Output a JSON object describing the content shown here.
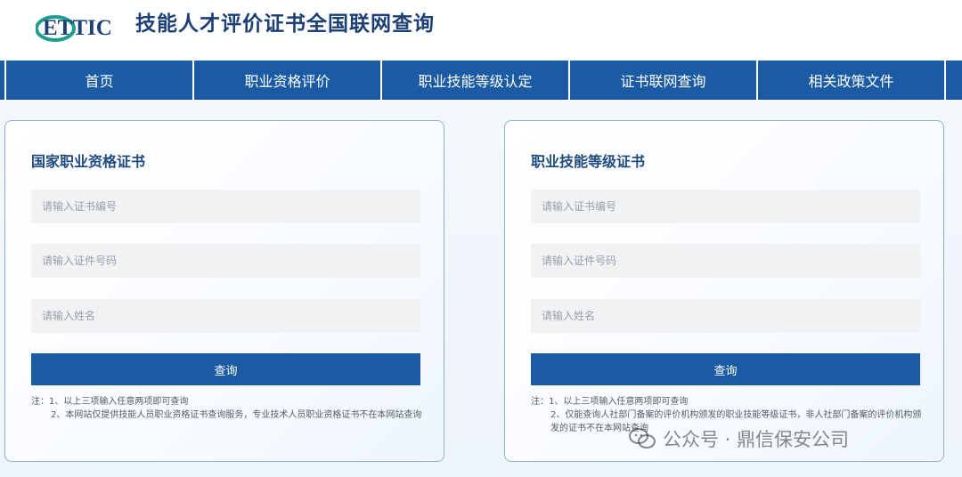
{
  "header": {
    "logo_text": "ETTIC",
    "title": "技能人才评价证书全国联网查询"
  },
  "nav": {
    "items": [
      "首页",
      "职业资格评价",
      "职业技能等级认定",
      "证书联网查询",
      "相关政策文件"
    ]
  },
  "cards": [
    {
      "title": "国家职业资格证书",
      "cert_no_placeholder": "请输入证书编号",
      "id_no_placeholder": "请输入证件号码",
      "name_placeholder": "请输入姓名",
      "query_label": "查询",
      "note_1": "注：1、以上三项输入任意两项即可查询",
      "note_2": "2、本网站仅提供技能人员职业资格证书查询服务，专业技术人员职业资格证书不在本网站查询"
    },
    {
      "title": "职业技能等级证书",
      "cert_no_placeholder": "请输入证书编号",
      "id_no_placeholder": "请输入证件号码",
      "name_placeholder": "请输入姓名",
      "query_label": "查询",
      "note_1": "注：1、以上三项输入任意两项即可查询",
      "note_2": "2、仅能查询人社部门备案的评价机构颁发的职业技能等级证书，非人社部门备案的评价机构颁发的证书不在本网站查询"
    }
  ],
  "watermark": {
    "text": "公众号 · 鼎信保安公司"
  },
  "colors": {
    "nav_bg": "#1a5ba3",
    "title": "#1c3f74",
    "logo_teal": "#1f9e8f",
    "logo_navy": "#1c3f74"
  }
}
